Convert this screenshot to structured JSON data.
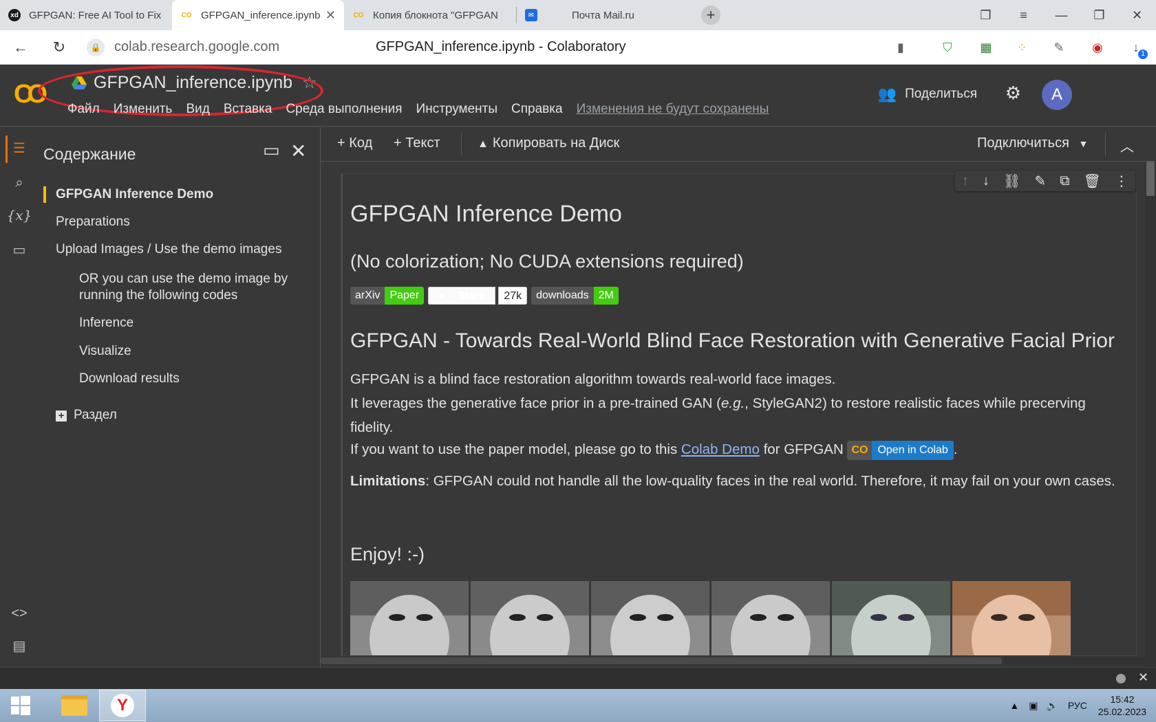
{
  "browser": {
    "tabs": [
      {
        "title": "GFPGAN: Free AI Tool to Fix",
        "favicon": "xd-icon"
      },
      {
        "title": "GFPGAN_inference.ipynb",
        "favicon": "colab-icon",
        "active": true
      },
      {
        "title": "Копия блокнота \"GFPGAN",
        "favicon": "colab-icon"
      },
      {
        "title": "Почта Mail.ru",
        "favicon": "mail-icon"
      }
    ],
    "url": "colab.research.google.com",
    "page_title": "GFPGAN_inference.ipynb - Colaboratory",
    "download_count": "1"
  },
  "colab": {
    "notebook_title": "GFPGAN_inference.ipynb",
    "menu": [
      "Файл",
      "Изменить",
      "Вид",
      "Вставка",
      "Среда выполнения",
      "Инструменты",
      "Справка"
    ],
    "unsaved": "Изменения не будут сохранены",
    "share": "Поделиться",
    "avatar": "A",
    "toolbar": {
      "code": "Код",
      "text": "Текст",
      "copy_to_drive": "Копировать на Диск",
      "connect": "Подключиться"
    }
  },
  "toc": {
    "title": "Содержание",
    "items": [
      {
        "label": "GFPGAN Inference Demo",
        "level": 1,
        "active": true
      },
      {
        "label": "Preparations",
        "level": 1
      },
      {
        "label": "Upload Images / Use the demo images",
        "level": 1
      },
      {
        "label": "OR you can use the demo image by running the following codes",
        "level": 2
      },
      {
        "label": "Inference",
        "level": 2
      },
      {
        "label": "Visualize",
        "level": 2
      },
      {
        "label": "Download results",
        "level": 2
      }
    ],
    "add_section": "Раздел"
  },
  "cell": {
    "h1": "GFPGAN Inference Demo",
    "subtitle": "(No colorization; No CUDA extensions required)",
    "badges": {
      "arxiv_left": "arXiv",
      "arxiv_right": "Paper",
      "stars_label": "Stars",
      "stars_count": "27k",
      "downloads_left": "downloads",
      "downloads_right": "2M"
    },
    "h2": "GFPGAN - Towards Real-World Blind Face Restoration with Generative Facial Prior",
    "p1": "GFPGAN is a blind face restoration algorithm towards real-world face images.",
    "p2_before": "It leverages the generative face prior in a pre-trained GAN (",
    "p2_em": "e.g.",
    "p2_after": ", StyleGAN2) to restore realistic faces while precerving fidelity.",
    "p3_before": "If you want to use the paper model, please go to this ",
    "p3_link": "Colab Demo",
    "p3_after": " for GFPGAN ",
    "colab_badge": "Open in Colab",
    "p3_end": ".",
    "limit_bold": "Limitations",
    "limit_rest": ": GFPGAN could not handle all the low-quality faces in the real world. Therefore, it may fail on your own cases.",
    "enjoy": "Enjoy! :-)"
  },
  "taskbar": {
    "lang": "РУС",
    "time": "15:42",
    "date": "25.02.2023"
  }
}
